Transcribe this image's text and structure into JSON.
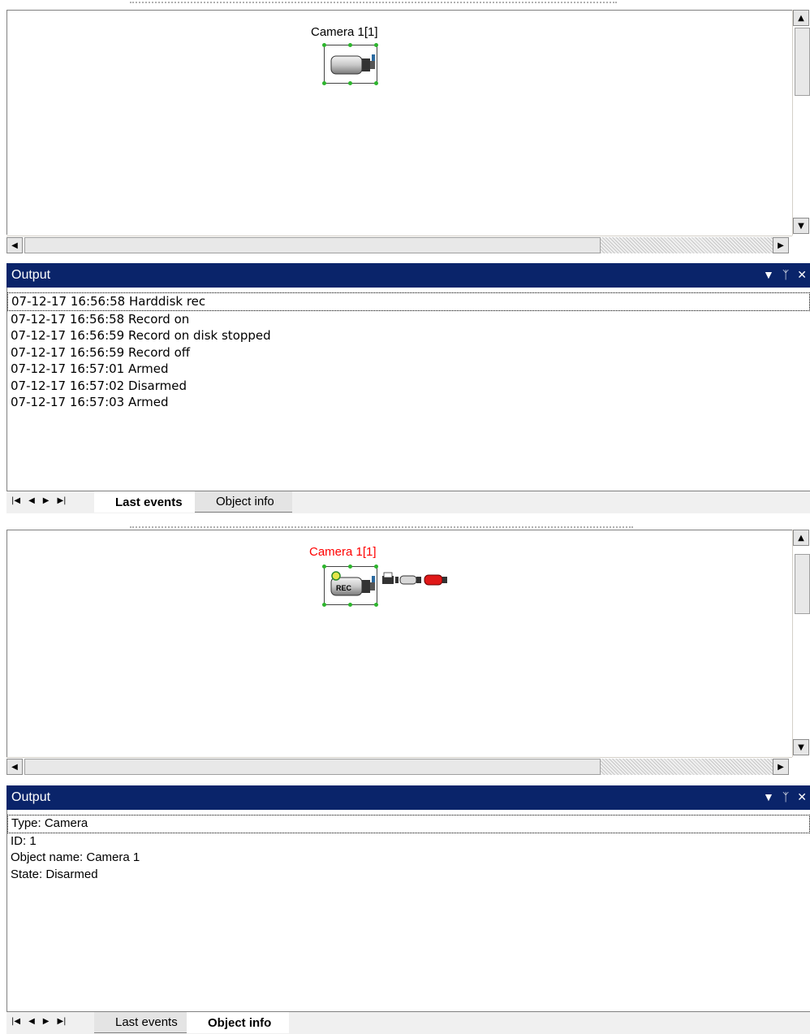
{
  "panels": [
    {
      "camera": {
        "label": "Camera 1[1]",
        "label_color": "#000000",
        "recording": false
      },
      "output": {
        "title": "Output",
        "lines": [
          "07-12-17 16:56:58 Harddisk rec",
          "07-12-17 16:56:58 Record on",
          "07-12-17 16:56:59 Record on disk stopped",
          "07-12-17 16:56:59 Record off",
          "07-12-17 16:57:01 Armed",
          "07-12-17 16:57:02 Disarmed",
          "07-12-17 16:57:03 Armed"
        ]
      },
      "tabs": {
        "last_events": "Last events",
        "object_info": "Object info",
        "active": "last_events"
      }
    },
    {
      "camera": {
        "label": "Camera 1[1]",
        "label_color": "#ff0000",
        "recording": true,
        "rec_label": "REC"
      },
      "output": {
        "title": "Output",
        "lines": [
          "Type: Camera",
          "ID: 1",
          "Object name: Camera 1",
          "State: Disarmed"
        ]
      },
      "tabs": {
        "last_events": "Last events",
        "object_info": "Object info",
        "active": "object_info"
      }
    }
  ],
  "colors": {
    "header_bg": "#0a246a",
    "handle": "#2db52d"
  },
  "icons": [
    "dropdown-arrow-icon",
    "pin-icon",
    "close-icon",
    "first-icon",
    "prev-icon",
    "next-icon",
    "last-icon",
    "camera-icon"
  ]
}
